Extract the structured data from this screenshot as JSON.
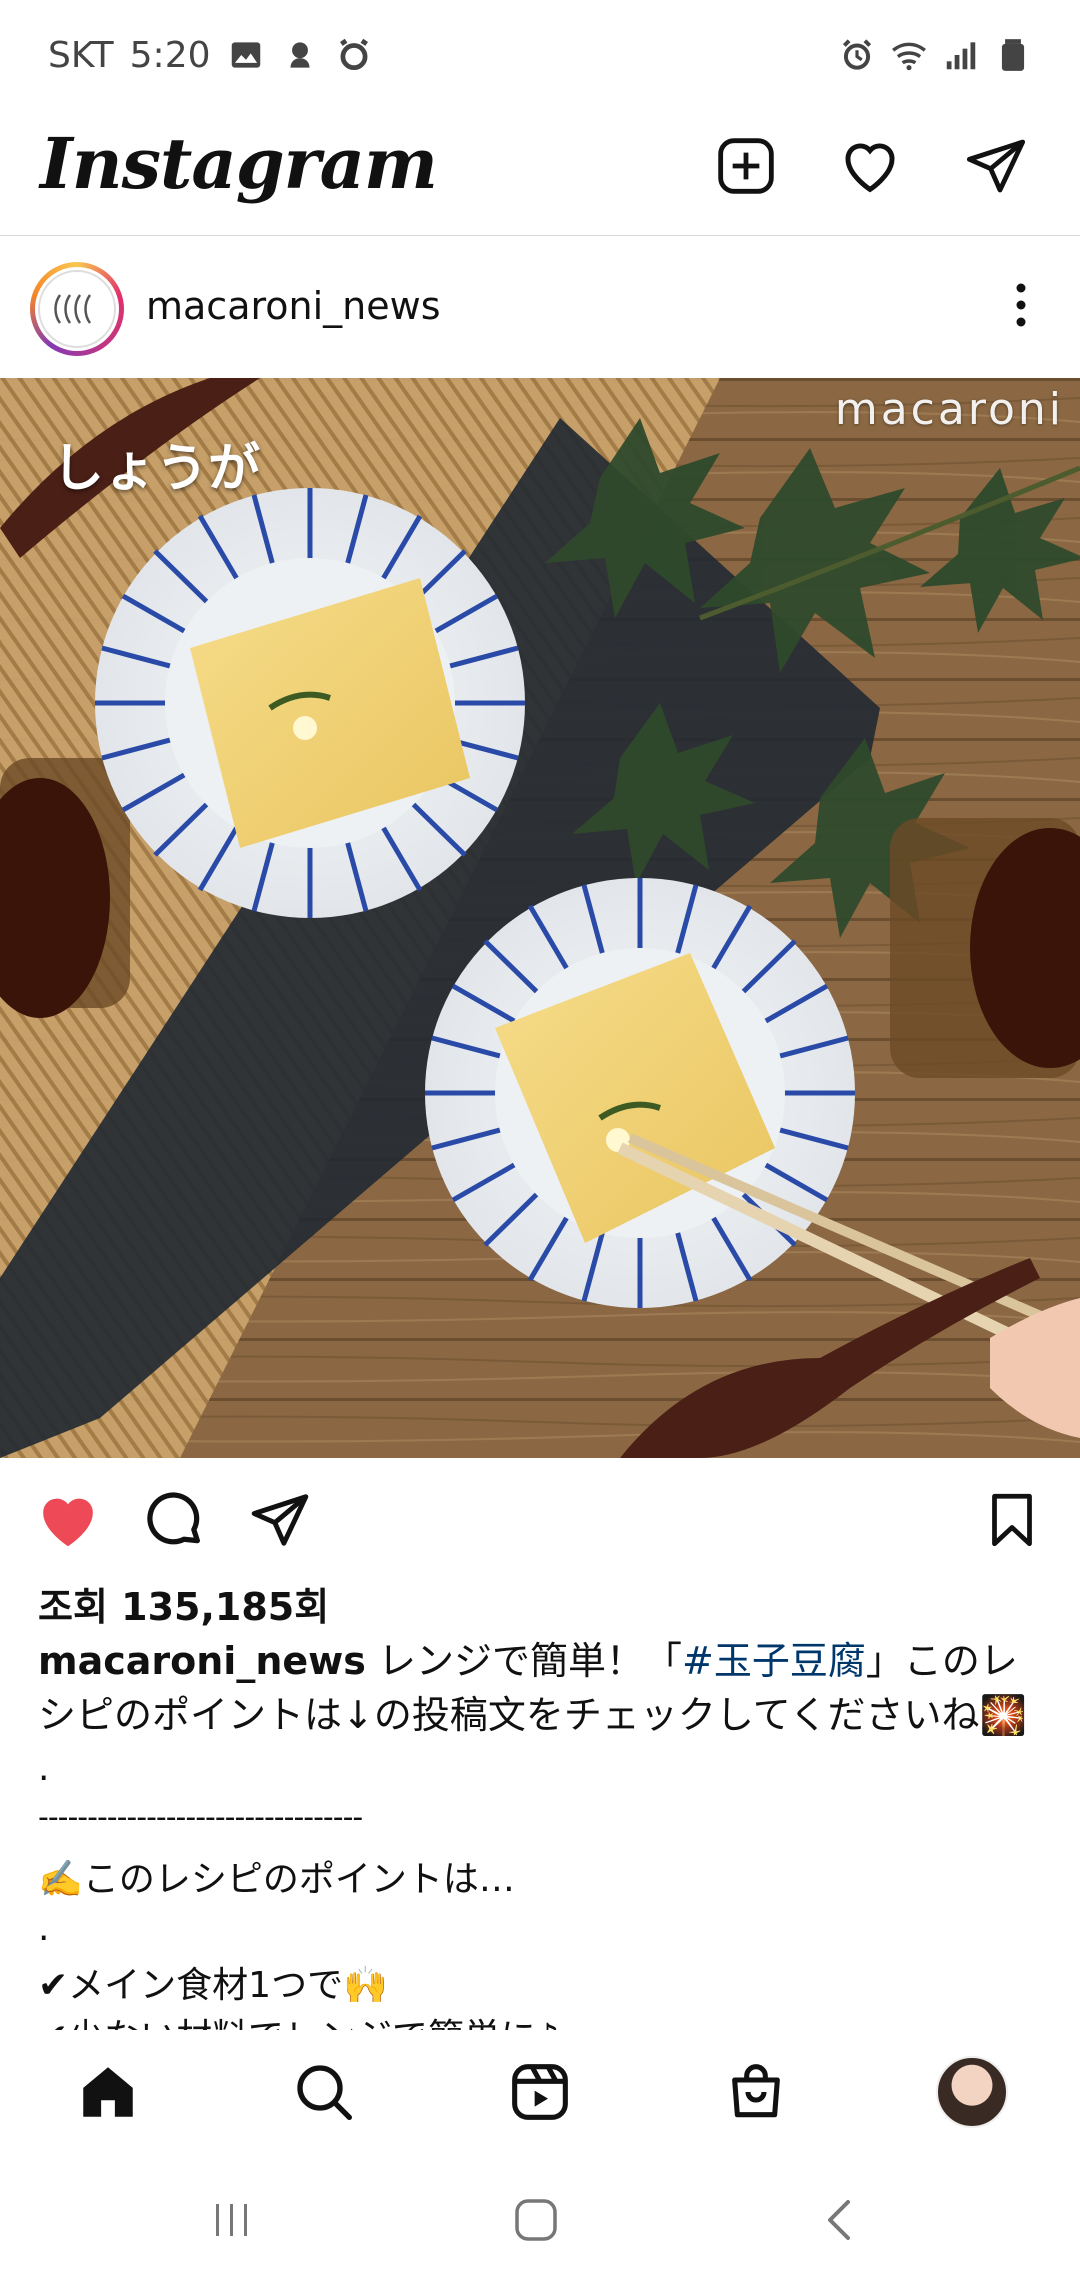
{
  "status_bar": {
    "carrier": "SKT",
    "time": "5:20",
    "left_icons": [
      "gallery-icon",
      "notification-icon",
      "alarm-app-icon"
    ],
    "right_icons": [
      "alarm-icon",
      "wifi-icon",
      "signal-icon",
      "battery-icon"
    ]
  },
  "topbar": {
    "logo": "Instagram",
    "icons": [
      "new-post-icon",
      "heart-icon",
      "direct-message-icon"
    ]
  },
  "post": {
    "username": "macaroni_news",
    "media": {
      "overlay_left": "しょうが",
      "overlay_right": "macaroni"
    },
    "liked": true,
    "views_text": "조회 135,185회",
    "caption": {
      "username": "macaroni_news",
      "text_before_tag": " レンジで簡単！「",
      "hashtag": "#玉子豆腐",
      "text_after_tag": "」このレシピのポイントは↓の投稿文をチェックしてくださいね🎇",
      "lines": [
        ".",
        "---------------------------------",
        "✍️このレシピのポイントは…",
        ".",
        "✔︎メイン食材1つで🙌",
        "✔︎少ない材料でレンジで簡単に♪"
      ]
    }
  },
  "bottom_nav": {
    "items": [
      "home-icon",
      "search-icon",
      "reels-icon",
      "shop-icon",
      "profile-avatar"
    ]
  },
  "system_nav": {
    "items": [
      "recent-apps-icon",
      "home-button-icon",
      "back-icon"
    ]
  },
  "colors": {
    "like_red": "#ed4956",
    "hashtag_blue": "#00376b",
    "text": "#111111"
  }
}
